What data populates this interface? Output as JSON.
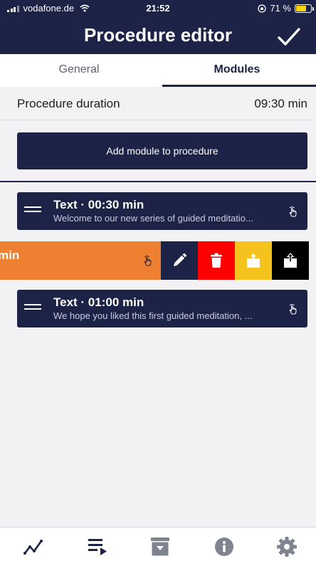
{
  "status_bar": {
    "carrier": "vodafone.de",
    "time": "21:52",
    "battery_text": "71 %",
    "battery_level": 0.71,
    "battery_color": "#ffd60a"
  },
  "header": {
    "title": "Procedure editor",
    "confirm_icon": "checkmark-icon"
  },
  "tabs": [
    {
      "label": "General",
      "active": false
    },
    {
      "label": "Modules",
      "active": true
    }
  ],
  "procedure": {
    "duration_label": "Procedure duration",
    "duration_value": "09:30 min"
  },
  "add_button_label": "Add module to procedure",
  "modules": [
    {
      "title": "Text · 00:30 min",
      "description": "Welcome to our new series of guided meditatio..."
    },
    {
      "partial_text": "min",
      "swiped_open": true
    },
    {
      "title": "Text · 01:00 min",
      "description": "We hope you liked this first guided meditation, ..."
    }
  ],
  "swipe_actions": [
    {
      "name": "edit",
      "icon": "pencil-icon",
      "color": "#1c2346"
    },
    {
      "name": "delete",
      "icon": "trash-icon",
      "color": "#fe0000"
    },
    {
      "name": "share",
      "icon": "share-icon",
      "color": "#f6c21d"
    },
    {
      "name": "export",
      "icon": "export-icon",
      "color": "#000000"
    }
  ],
  "bottom_nav": [
    {
      "icon": "chart-line-icon",
      "active": false
    },
    {
      "icon": "playlist-icon",
      "active": true
    },
    {
      "icon": "archive-download-icon",
      "active": false
    },
    {
      "icon": "info-icon",
      "active": false
    },
    {
      "icon": "settings-gear-icon",
      "active": false
    }
  ],
  "colors": {
    "primary": "#1c2346",
    "swiped_module": "#ee8131",
    "background": "#f2f2f4"
  }
}
